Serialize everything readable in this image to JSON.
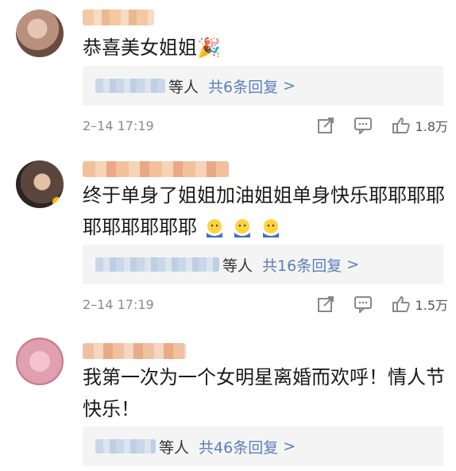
{
  "comments": [
    {
      "text": "恭喜美女姐姐🎉",
      "reply_suffix": "等人",
      "reply_link": "共6条回复",
      "date": "2–14 17:19",
      "likes": "1.8万"
    },
    {
      "text": "终于单身了姐姐加油姐姐单身快乐耶耶耶耶耶耶耶耶耶耶",
      "emoji_count": 3,
      "reply_suffix": "等人",
      "reply_link": "共16条回复",
      "date": "2–14 17:19",
      "likes": "1.5万"
    },
    {
      "text": "我第一次为一个女明星离婚而欢呼！情人节快乐！",
      "reply_suffix": "等人",
      "reply_link": "共46条回复"
    }
  ],
  "icons": [
    "share-icon",
    "comment-icon",
    "like-icon",
    "chevron-right-icon"
  ],
  "colors": {
    "link": "#5b7fbb",
    "reply_bg": "#f4f4f4",
    "meta_text": "#8a8a8a"
  }
}
